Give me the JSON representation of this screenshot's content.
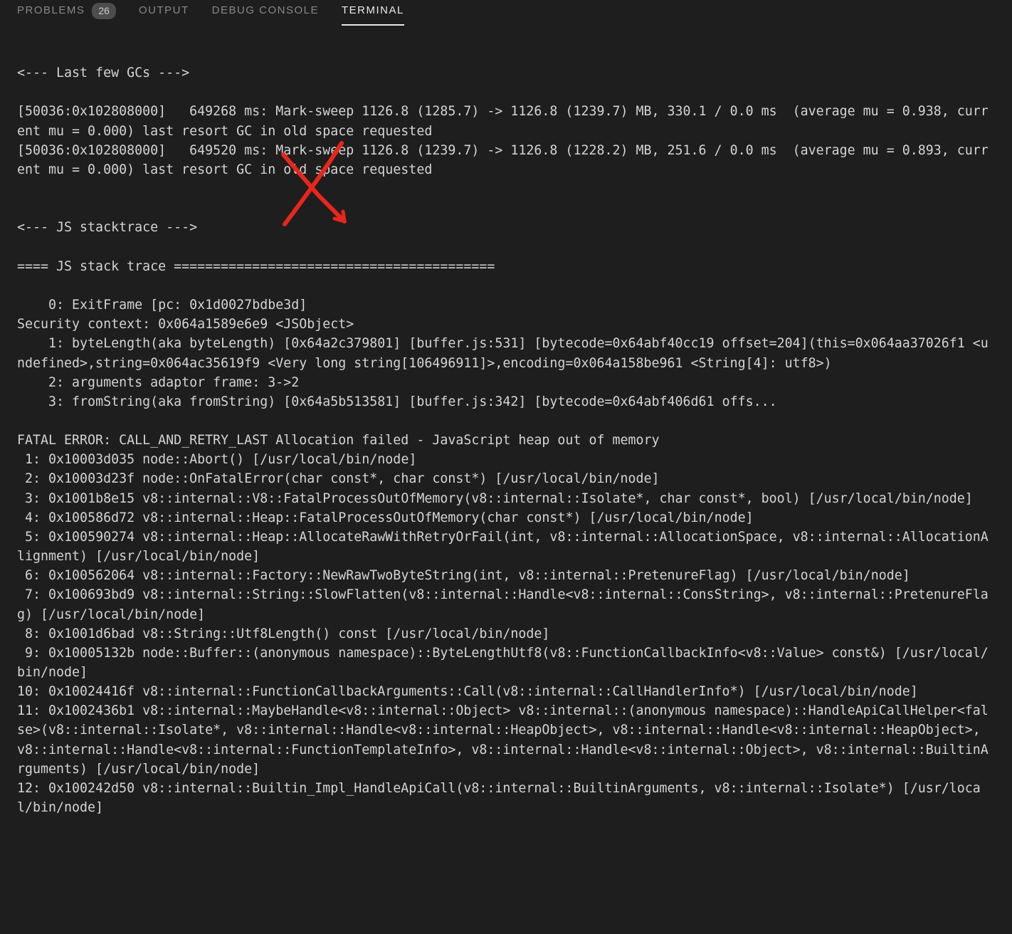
{
  "tabs": {
    "problems": {
      "label": "PROBLEMS",
      "badge": "26"
    },
    "output": {
      "label": "OUTPUT"
    },
    "debug": {
      "label": "DEBUG CONSOLE"
    },
    "terminal": {
      "label": "TERMINAL"
    }
  },
  "terminal_lines": [
    "",
    "<--- Last few GCs --->",
    "",
    "[50036:0x102808000]   649268 ms: Mark-sweep 1126.8 (1285.7) -> 1126.8 (1239.7) MB, 330.1 / 0.0 ms  (average mu = 0.938, current mu = 0.000) last resort GC in old space requested",
    "[50036:0x102808000]   649520 ms: Mark-sweep 1126.8 (1239.7) -> 1126.8 (1228.2) MB, 251.6 / 0.0 ms  (average mu = 0.893, current mu = 0.000) last resort GC in old space requested",
    "",
    "",
    "<--- JS stacktrace --->",
    "",
    "==== JS stack trace =========================================",
    "",
    "    0: ExitFrame [pc: 0x1d0027bdbe3d]",
    "Security context: 0x064a1589e6e9 <JSObject>",
    "    1: byteLength(aka byteLength) [0x64a2c379801] [buffer.js:531] [bytecode=0x64abf40cc19 offset=204](this=0x064aa37026f1 <undefined>,string=0x064ac35619f9 <Very long string[106496911]>,encoding=0x064a158be961 <String[4]: utf8>)",
    "    2: arguments adaptor frame: 3->2",
    "    3: fromString(aka fromString) [0x64a5b513581] [buffer.js:342] [bytecode=0x64abf406d61 offs...",
    "",
    "FATAL ERROR: CALL_AND_RETRY_LAST Allocation failed - JavaScript heap out of memory",
    " 1: 0x10003d035 node::Abort() [/usr/local/bin/node]",
    " 2: 0x10003d23f node::OnFatalError(char const*, char const*) [/usr/local/bin/node]",
    " 3: 0x1001b8e15 v8::internal::V8::FatalProcessOutOfMemory(v8::internal::Isolate*, char const*, bool) [/usr/local/bin/node]",
    " 4: 0x100586d72 v8::internal::Heap::FatalProcessOutOfMemory(char const*) [/usr/local/bin/node]",
    " 5: 0x100590274 v8::internal::Heap::AllocateRawWithRetryOrFail(int, v8::internal::AllocationSpace, v8::internal::AllocationAlignment) [/usr/local/bin/node]",
    " 6: 0x100562064 v8::internal::Factory::NewRawTwoByteString(int, v8::internal::PretenureFlag) [/usr/local/bin/node]",
    " 7: 0x100693bd9 v8::internal::String::SlowFlatten(v8::internal::Handle<v8::internal::ConsString>, v8::internal::PretenureFlag) [/usr/local/bin/node]",
    " 8: 0x1001d6bad v8::String::Utf8Length() const [/usr/local/bin/node]",
    " 9: 0x10005132b node::Buffer::(anonymous namespace)::ByteLengthUtf8(v8::FunctionCallbackInfo<v8::Value> const&) [/usr/local/bin/node]",
    "10: 0x10024416f v8::internal::FunctionCallbackArguments::Call(v8::internal::CallHandlerInfo*) [/usr/local/bin/node]",
    "11: 0x1002436b1 v8::internal::MaybeHandle<v8::internal::Object> v8::internal::(anonymous namespace)::HandleApiCallHelper<false>(v8::internal::Isolate*, v8::internal::Handle<v8::internal::HeapObject>, v8::internal::Handle<v8::internal::HeapObject>, v8::internal::Handle<v8::internal::FunctionTemplateInfo>, v8::internal::Handle<v8::internal::Object>, v8::internal::BuiltinArguments) [/usr/local/bin/node]",
    "12: 0x100242d50 v8::internal::Builtin_Impl_HandleApiCall(v8::internal::BuiltinArguments, v8::internal::Isolate*) [/usr/local/bin/node]"
  ]
}
